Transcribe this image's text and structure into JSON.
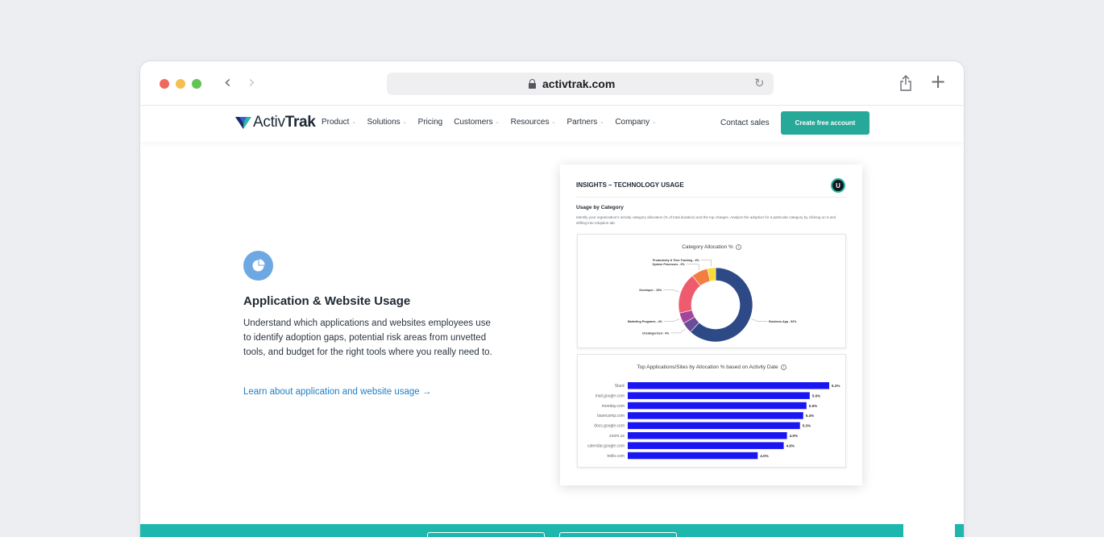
{
  "browser": {
    "url": "activtrak.com"
  },
  "header": {
    "logo_light": "Activ",
    "logo_bold": "Trak",
    "menu": [
      {
        "label": "Product",
        "has_dropdown": true
      },
      {
        "label": "Solutions",
        "has_dropdown": true
      },
      {
        "label": "Pricing",
        "has_dropdown": false
      },
      {
        "label": "Customers",
        "has_dropdown": true
      },
      {
        "label": "Resources",
        "has_dropdown": true
      },
      {
        "label": "Partners",
        "has_dropdown": true
      },
      {
        "label": "Company",
        "has_dropdown": true
      }
    ],
    "contact_label": "Contact sales",
    "cta_label": "Create free account"
  },
  "feature": {
    "title": "Application & Website Usage",
    "description": "Understand which applications and websites employees use to identify adoption gaps, potential risk areas from unvetted tools, and budget for the right tools where you really need to.",
    "link_label": "Learn about application and website usage →"
  },
  "dashboard": {
    "title": "INSIGHTS – TECHNOLOGY USAGE",
    "avatar_initial": "U",
    "section_title": "Usage by Category",
    "section_desc": "Identify your organization's activity category allocation (% of total duration) and the top charges. Analyze the adoption for a particular category by clicking on it and drilling into Adoption tab.",
    "pie_title": "Category Allocation %",
    "bar_title": "Top Applications/Sites by Allocation % based on Activity Date"
  },
  "chart_data": [
    {
      "type": "pie",
      "title": "Category Allocation %",
      "slices": [
        {
          "label": "Business App - 52%",
          "value": 52,
          "color": "#2e4a86"
        },
        {
          "label": "Uncategorized - 4%",
          "value": 4,
          "color": "#6b4c9a"
        },
        {
          "label": "Marketing Programs - 4%",
          "value": 4,
          "color": "#a3459a"
        },
        {
          "label": "Developer - 15%",
          "value": 15,
          "color": "#ee5b6e"
        },
        {
          "label": "System Processes - 6%",
          "value": 6,
          "color": "#f47e42"
        },
        {
          "label": "Productivity & Time Tracking - 3%",
          "value": 3,
          "color": "#f7dc34"
        }
      ]
    },
    {
      "type": "bar",
      "title": "Top Applications/Sites by Allocation % based on Activity Date",
      "categories": [
        "Slack",
        "mail.google.com",
        "monday.com",
        "basecamp.com",
        "docs.google.com",
        "zoom.us",
        "calendar.google.com",
        "trello.com"
      ],
      "values": [
        6.2,
        5.6,
        5.5,
        5.4,
        5.3,
        4.9,
        4.8,
        4.0
      ],
      "value_labels": [
        "6.2%",
        "5.6%",
        "5.5%",
        "5.4%",
        "5.3%",
        "4.9%",
        "4.8%",
        "4.0%"
      ],
      "color": "#1a16f2"
    }
  ]
}
